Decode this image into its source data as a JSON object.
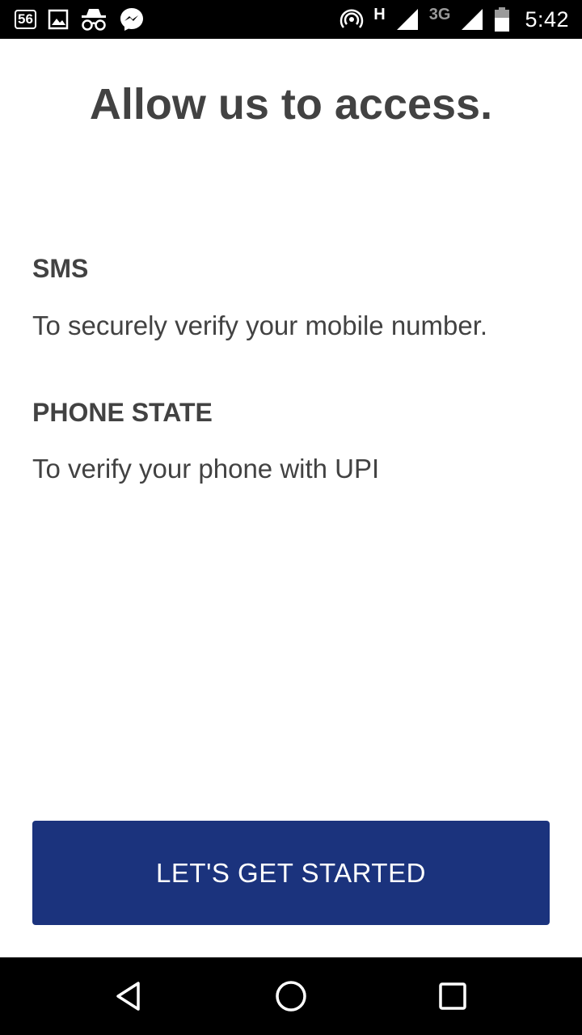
{
  "status_bar": {
    "badge": "56",
    "network_h": "H",
    "network_3g": "3G",
    "time": "5:42",
    "icons": [
      "badge-56-icon",
      "gallery-icon",
      "incognito-icon",
      "messenger-icon",
      "hotspot-icon",
      "signal-icon",
      "signal-icon",
      "battery-icon"
    ]
  },
  "page": {
    "title": "Allow us to access."
  },
  "permissions": [
    {
      "title": "SMS",
      "description": "To securely verify your mobile number."
    },
    {
      "title": "PHONE STATE",
      "description": "To verify your phone with UPI"
    }
  ],
  "cta": {
    "label": "LET'S GET STARTED"
  },
  "colors": {
    "button": "#1b337d",
    "text": "#424242"
  },
  "nav_bar": {
    "icons": [
      "back-icon",
      "home-icon",
      "recents-icon"
    ]
  }
}
